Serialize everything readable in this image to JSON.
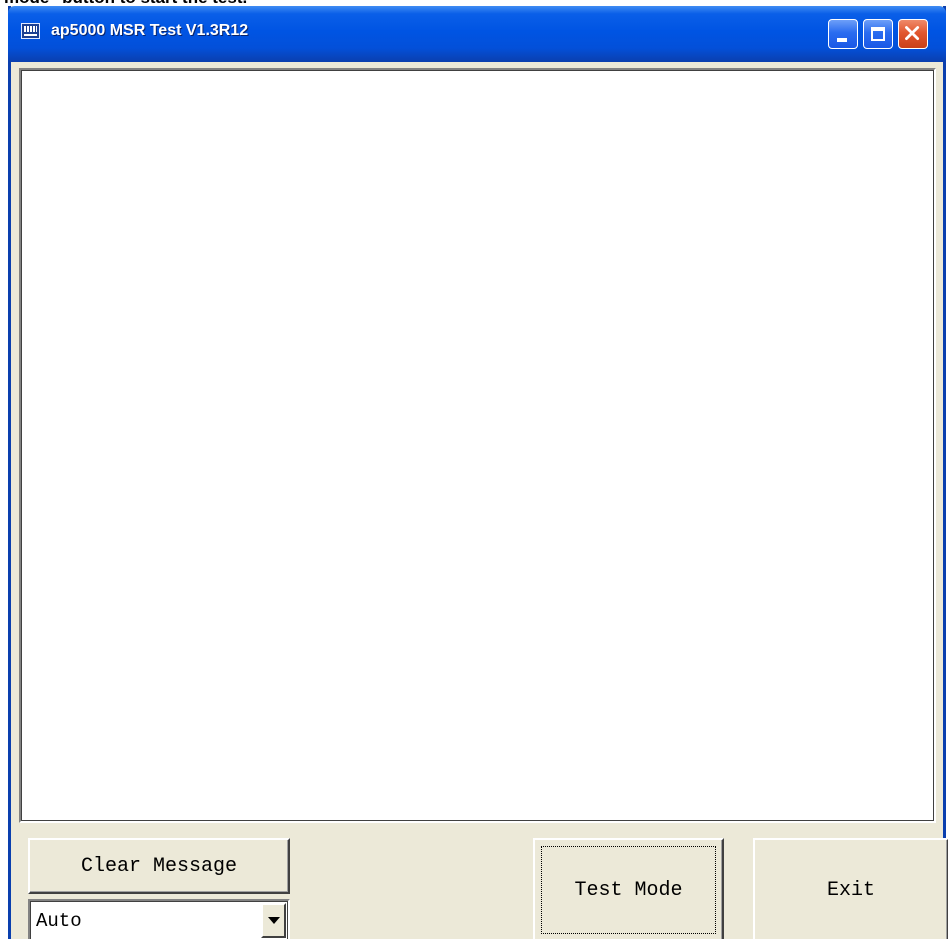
{
  "caption": {
    "text": "mode\" button to start the test."
  },
  "window": {
    "title": "ap5000 MSR Test V1.3R12",
    "icon": "app-window-icon",
    "controls": {
      "minimize_icon": "minimize-icon",
      "maximize_icon": "maximize-icon",
      "close_icon": "close-icon"
    },
    "titlebar_color": "#0054e3",
    "close_color": "#e2572f"
  },
  "main": {
    "message_area": {
      "value": "",
      "placeholder": ""
    },
    "clear_message_label": "Clear Message",
    "mode_select": {
      "selected": "Auto",
      "dropdown_icon": "dropdown-arrow-icon"
    },
    "test_mode_label": "Test Mode",
    "exit_label": "Exit"
  },
  "colors": {
    "face": "#ece9d8",
    "content_background": "#ffffff"
  }
}
